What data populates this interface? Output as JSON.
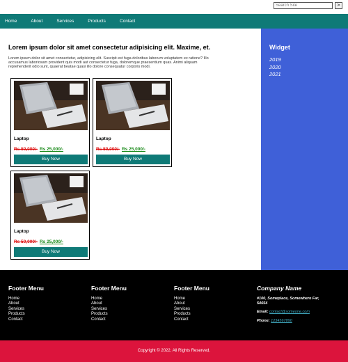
{
  "search": {
    "placeholder": "Search Site",
    "button_label": ">"
  },
  "nav": {
    "items": [
      "Home",
      "About",
      "Services",
      "Products",
      "Contact"
    ]
  },
  "content": {
    "heading": "Lorem ipsum dolor sit amet consectetur adipisicing elit. Maxime, et.",
    "paragraph_lines": [
      "Lorem ipsum dolor sit amet consectetur, adipisicing elit. Suscipit est fuga doloribus laborum voluptatem ex ratione? Illo",
      "accusamus laboriosam provident quis modi aut consectetur fuga, doloremque praesentium quas. Animi aliquam",
      "reprehenderit odio sunt, quaerat beatae quasi illo dolore consequatur corporis modi."
    ]
  },
  "products": [
    {
      "title": "Laptop",
      "old_price": "Rs 50,000/-",
      "new_price": "Rs 25,000/-",
      "button": "Buy Now"
    },
    {
      "title": "Laptop",
      "old_price": "Rs 50,000/-",
      "new_price": "Rs 25,000/-",
      "button": "Buy Now"
    },
    {
      "title": "Laptop",
      "old_price": "Rs 50,000/-",
      "new_price": "Rs 25,000/-",
      "button": "Buy Now"
    }
  ],
  "widget": {
    "title": "Widget",
    "items": [
      "2019",
      "2020",
      "2021"
    ]
  },
  "footer": {
    "menus": [
      {
        "title": "Footer Menu",
        "links": [
          "Home",
          "About",
          "Services",
          "Products",
          "Contact"
        ]
      },
      {
        "title": "Footer Menu",
        "links": [
          "Home",
          "About",
          "Services",
          "Products",
          "Contact"
        ]
      },
      {
        "title": "Footer Menu",
        "links": [
          "Home",
          "About",
          "Services",
          "Products",
          "Contact"
        ]
      }
    ],
    "company": {
      "name": "Company Name",
      "address_lines": [
        "#100, Someplace, Somewhere Far,",
        "54654"
      ],
      "email_label": "Email:",
      "email": "contact@someone.com",
      "phone_label": "Phone:",
      "phone": "1234567890"
    }
  },
  "copyright": "Copyright © 2022. All Rights Reserved.",
  "colors": {
    "nav": "#0f7a77",
    "sidebar": "#3f60d8",
    "footer": "#000000",
    "copyright_bar": "#dc143c",
    "old_price": "#dd1111",
    "new_price": "#1a8a1a"
  }
}
